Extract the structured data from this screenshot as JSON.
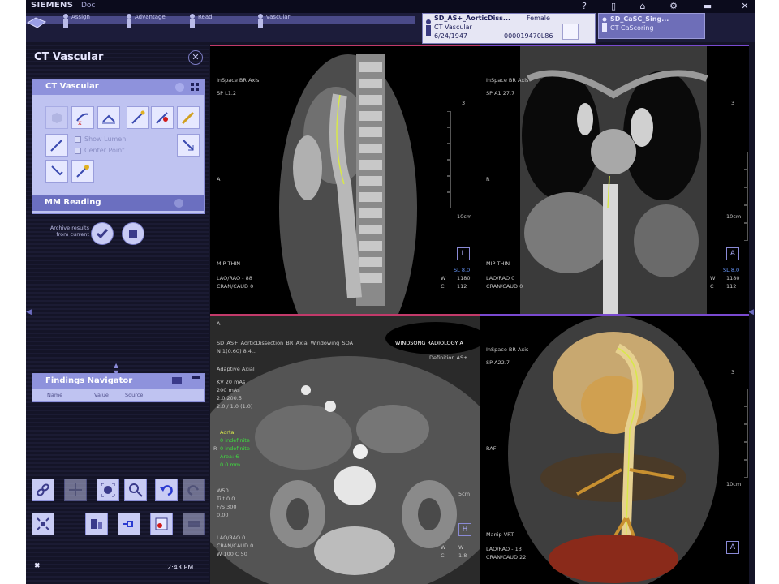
{
  "topbar": {
    "brand": "SIEMENS",
    "app_label": "Doc",
    "icons": [
      "help-icon",
      "save-icon",
      "home-icon",
      "tools-icon",
      "minimize-icon",
      "close-icon"
    ]
  },
  "tasks": [
    {
      "label": "Assign"
    },
    {
      "label": "Advantage"
    },
    {
      "label": "Read"
    },
    {
      "label": "vascular"
    }
  ],
  "patient": {
    "name": "SD_AS+_AorticDiss...",
    "sex": "Female",
    "workflow": "CT Vascular",
    "dob": "6/24/1947",
    "id": "000019470L86"
  },
  "patient2": {
    "name": "SD_CaSC_Sing...",
    "workflow": "CT CaScoring"
  },
  "panel": {
    "title": "CT Vascular",
    "ctv_title": "CT Vascular",
    "checks": [
      "Show Lumen",
      "Center Point"
    ],
    "mm_reading": "MM Reading",
    "archive_text": "Archive results from current",
    "findings_title": "Findings Navigator",
    "findings_cols": [
      "Name",
      "Value",
      "Source",
      "",
      "",
      ""
    ],
    "clock": "2:43 PM"
  },
  "viewports": {
    "sagittal": {
      "top_left": [
        "InSpace BR Axis",
        "SP L1.2"
      ],
      "bottom_left": [
        "MIP THIN",
        "",
        "LAO/RAO - 88",
        "CRAN/CAUD 0"
      ],
      "bottom_right": [
        "SL 8.0",
        "1180",
        "112"
      ],
      "wl_labels": [
        "W",
        "C"
      ],
      "orient": "L",
      "side": "A",
      "scale_label": "10cm",
      "scale_num": "3"
    },
    "coronal": {
      "top_left": [
        "InSpace BR Axis",
        "SP A1 27.7"
      ],
      "bottom_left": [
        "MIP THIN",
        "",
        "LAO/RAO 0",
        "CRAN/CAUD 0"
      ],
      "bottom_right": [
        "SL 8.0",
        "1180",
        "112"
      ],
      "wl_labels": [
        "W",
        "C"
      ],
      "orient": "A",
      "side": "R",
      "scale_label": "10cm",
      "scale_num": "3"
    },
    "axial": {
      "header": "SD_AS+_AorticDissection_BR_Axial Windowing_SOA",
      "header2": "N 1(0.60) 8.4...",
      "hospital": "WINDSONG RADIOLOGY A",
      "definition": "Definition AS+",
      "info": [
        "Adaptive Axial",
        "",
        "KV 20 mAs",
        "200 mAs",
        "2.0 200.5",
        "2.0 / 1.0 (1.0)"
      ],
      "measures": [
        "Aorta",
        "0 indefinite",
        "0 indefinite",
        "Area: 6",
        "0.0 mm"
      ],
      "bottom_left": [
        "W50",
        "Tilt 0.0",
        "F/S 300",
        "0.00",
        "",
        "LAO/RAO 0",
        "CRAN/CAUD 0",
        "W 100 C 50"
      ],
      "bottom_right": [
        "W",
        "C"
      ],
      "wl_values": [
        "W",
        "1.8"
      ],
      "orient": "H",
      "side": "R",
      "scale_label": "5cm"
    },
    "vrt": {
      "top_left": [
        "InSpace BR Axis",
        "SP A22.7"
      ],
      "bottom_left": [
        "Manip VRT",
        "",
        "LAO/RAO - 13",
        "CRAN/CAUD 22"
      ],
      "orient": "A",
      "side": "RAF",
      "scale_label": "10cm",
      "scale_num": "3"
    }
  },
  "colors": {
    "app_bg": "#141427",
    "panel_accent": "#bfc3f1",
    "header_accent": "#8e92dc",
    "overlay_green": "#3ede3e",
    "overlay_yellow": "#d8e84a"
  }
}
